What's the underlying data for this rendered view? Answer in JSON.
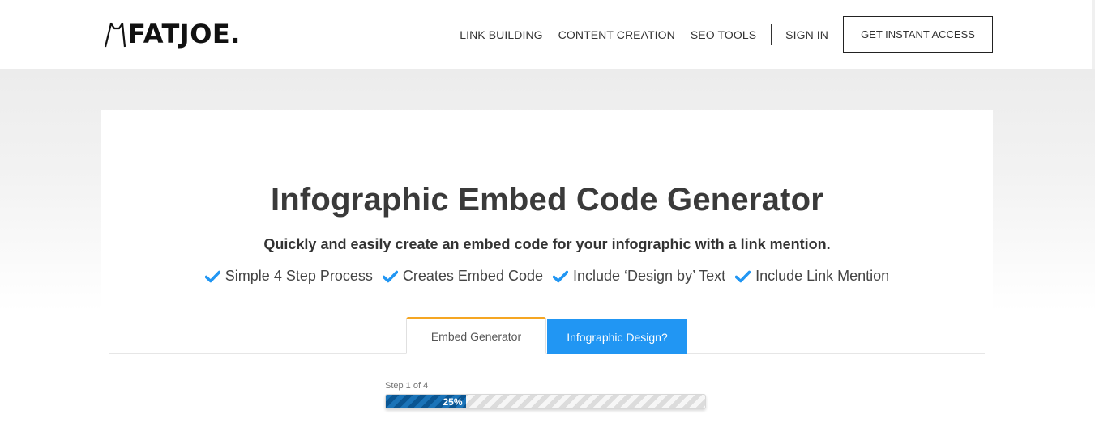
{
  "brand": {
    "name": "FATJOE."
  },
  "nav": {
    "links": [
      "LINK BUILDING",
      "CONTENT CREATION",
      "SEO TOOLS"
    ],
    "sign_in": "SIGN IN",
    "cta": "GET INSTANT ACCESS"
  },
  "hero": {
    "title": "Infographic Embed Code Generator",
    "subtitle": "Quickly and easily create an embed code for your infographic with a link mention.",
    "features": [
      "Simple 4 Step Process",
      "Creates Embed Code",
      "Include ‘Design by’ Text",
      "Include Link Mention"
    ]
  },
  "tabs": {
    "embed": "Embed Generator",
    "design": "Infographic Design?",
    "active": "embed"
  },
  "progress": {
    "step_label": "Step 1 of 4",
    "percent": 25,
    "percent_label": "25%"
  },
  "colors": {
    "accent_blue": "#2196f3",
    "tab_highlight": "#f5a623",
    "check": "#2196f3",
    "progress_fill": "#0b5fa0"
  },
  "icons": {
    "check": "check-icon",
    "logo": "cat-ears-icon"
  }
}
